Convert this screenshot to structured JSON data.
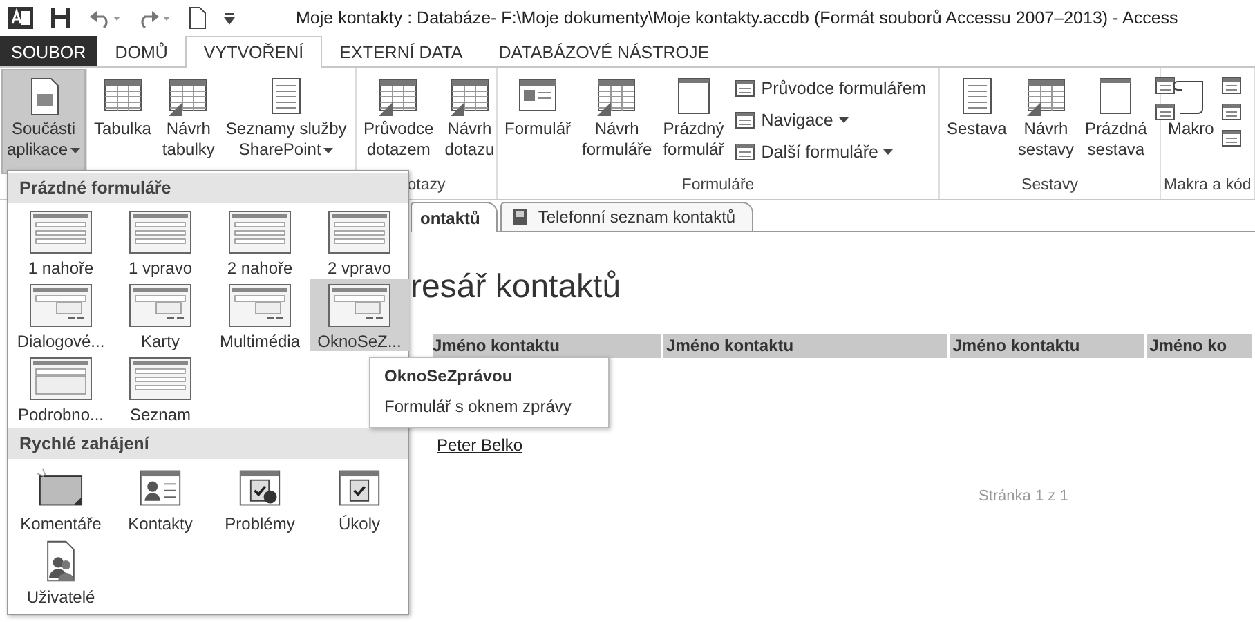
{
  "title_bar": {
    "title": "Moje kontakty : Databáze- F:\\Moje dokumenty\\Moje kontakty.accdb (Formát souborů Accessu 2007–2013) - Access"
  },
  "ribbon_tabs": [
    {
      "label": "SOUBOR",
      "kind": "file",
      "selected": false
    },
    {
      "label": "DOMŮ",
      "kind": "tab",
      "selected": false
    },
    {
      "label": "VYTVOŘENÍ",
      "kind": "tab",
      "selected": true
    },
    {
      "label": "EXTERNÍ DATA",
      "kind": "tab",
      "selected": false
    },
    {
      "label": "DATABÁZOVÉ NÁSTROJE",
      "kind": "tab",
      "selected": false
    }
  ],
  "ribbon_groups": [
    {
      "items": [
        {
          "kind": "large",
          "lines": [
            "Součásti",
            "aplikace"
          ],
          "dropdown": true,
          "pressed": true
        }
      ]
    },
    {
      "items": [
        {
          "kind": "large",
          "lines": [
            "Tabulka"
          ],
          "pressed": false
        },
        {
          "kind": "large",
          "lines": [
            "Návrh",
            "tabulky"
          ],
          "pressed": false
        },
        {
          "kind": "large",
          "lines": [
            "Seznamy služby",
            "SharePoint"
          ],
          "dropdown": true,
          "pressed": false
        }
      ]
    },
    {
      "label": "otazy",
      "items": [
        {
          "kind": "large",
          "lines": [
            "Průvodce",
            "dotazem"
          ],
          "pressed": false
        },
        {
          "kind": "large",
          "lines": [
            "Návrh",
            "dotazu"
          ],
          "pressed": false
        }
      ]
    },
    {
      "label": "Formuláře",
      "items": [
        {
          "kind": "large",
          "lines": [
            "Formulář"
          ],
          "pressed": false
        },
        {
          "kind": "large",
          "lines": [
            "Návrh",
            "formuláře"
          ],
          "pressed": false
        },
        {
          "kind": "large",
          "lines": [
            "Prázdný",
            "formulář"
          ],
          "pressed": false
        },
        {
          "kind": "small",
          "lines": [
            "Průvodce formulářem"
          ],
          "pressed": false
        },
        {
          "kind": "small",
          "lines": [
            "Navigace"
          ],
          "dropdown": true,
          "pressed": false
        },
        {
          "kind": "small",
          "lines": [
            "Další formuláře"
          ],
          "dropdown": true,
          "pressed": false
        }
      ]
    },
    {
      "label": "Sestavy",
      "items": [
        {
          "kind": "large",
          "lines": [
            "Sestava"
          ],
          "pressed": false
        },
        {
          "kind": "large",
          "lines": [
            "Návrh",
            "sestavy"
          ],
          "pressed": false
        },
        {
          "kind": "large",
          "lines": [
            "Prázdná",
            "sestava"
          ],
          "pressed": false
        },
        {
          "kind": "icon"
        },
        {
          "kind": "icon"
        }
      ]
    },
    {
      "label": "Makra a kód",
      "items": [
        {
          "kind": "large",
          "lines": [
            "Makro"
          ],
          "pressed": false
        },
        {
          "kind": "icon"
        },
        {
          "kind": "icon"
        },
        {
          "kind": "icon"
        }
      ]
    }
  ],
  "document_tabs": [
    {
      "label": "ontaktů",
      "selected": true
    },
    {
      "label": "Telefonní seznam kontaktů",
      "selected": false
    }
  ],
  "report": {
    "title": "resář kontaktů",
    "columns": [
      "Jméno kontaktu",
      "Jméno kontaktu",
      "Jméno kontaktu",
      "Jméno ko"
    ],
    "link": "Peter Belko",
    "page": "Stránka 1 z 1"
  },
  "gallery": {
    "sections": [
      {
        "title": "Prázdné formuláře",
        "items": [
          {
            "label": "1 nahoře",
            "selected": false
          },
          {
            "label": "1 vpravo",
            "selected": false
          },
          {
            "label": "2 nahoře",
            "selected": false
          },
          {
            "label": "2 vpravo",
            "selected": false
          },
          {
            "label": "Dialogové...",
            "selected": false
          },
          {
            "label": "Karty",
            "selected": false
          },
          {
            "label": "Multimédia",
            "selected": false
          },
          {
            "label": "OknoSeZ...",
            "selected": true
          },
          {
            "label": "Podrobno...",
            "selected": false
          },
          {
            "label": "Seznam",
            "selected": false
          }
        ]
      },
      {
        "title": "Rychlé zahájení",
        "items": [
          {
            "label": "Komentáře",
            "selected": false
          },
          {
            "label": "Kontakty",
            "selected": false
          },
          {
            "label": "Problémy",
            "selected": false
          },
          {
            "label": "Úkoly",
            "selected": false
          },
          {
            "label": "Uživatelé",
            "selected": false
          }
        ]
      }
    ]
  },
  "tooltip": {
    "title": "OknoSeZprávou",
    "description": "Formulář s oknem zprávy"
  }
}
